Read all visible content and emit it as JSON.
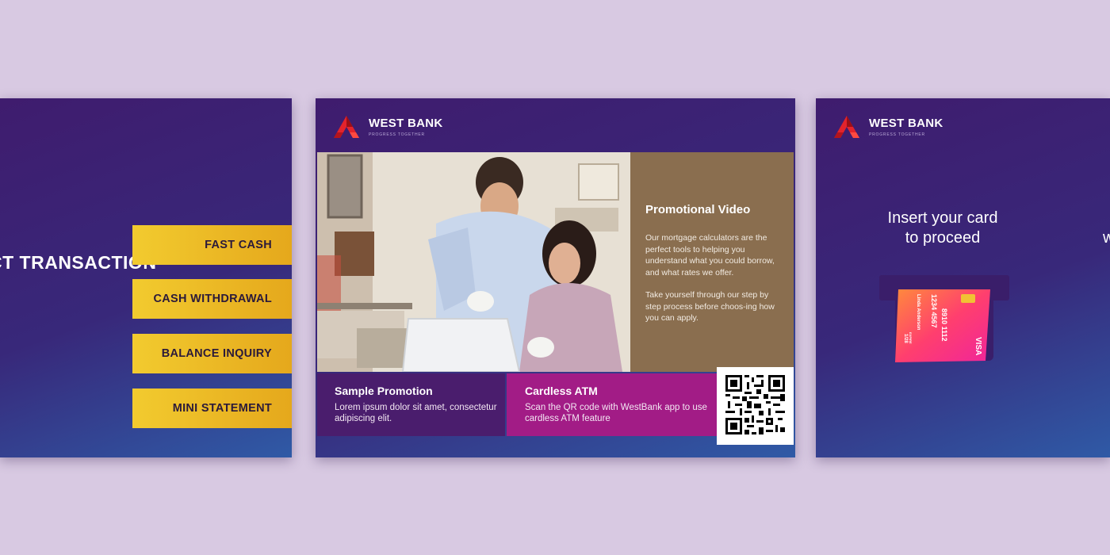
{
  "left_screen": {
    "title_partial": "CT TRANSACTION",
    "buttons": [
      "FAST CASH",
      "CASH WITHDRAWAL",
      "BALANCE INQUIRY",
      "MINI STATEMENT"
    ]
  },
  "brand": {
    "name": "WEST BANK",
    "tagline": "PROGRESS TOGETHER"
  },
  "middle_screen": {
    "promo_video": {
      "title": "Promotional Video",
      "text1": "Our mortgage calculators are the perfect tools to helping you understand what you could borrow, and what rates we offer.",
      "text2": "Take yourself through our step by step process before choos-ing how you can apply."
    },
    "sample_promotion": {
      "title": "Sample Promotion",
      "text": "Lorem ipsum dolor sit amet, consectetur adipiscing elit."
    },
    "cardless_atm": {
      "title": "Cardless ATM",
      "text": "Scan the QR code with WestBank app to use cardless ATM feature"
    }
  },
  "right_screen": {
    "line1": "Insert your card",
    "line2": "to proceed",
    "edge_char": "w",
    "card": {
      "number_line1": "1234 4567",
      "number_line2": "8910 1112",
      "name": "Linda Anderson",
      "expiry_label": "EXPIRE",
      "expiry": "1/28",
      "brand": "VISA"
    }
  },
  "colors": {
    "background": "#d8c9e2",
    "screen_top": "#3f1c6e",
    "screen_bottom": "#2f5aa6",
    "button_yellow": "#f2cb2f",
    "promo_brown": "#8a6e4f",
    "promo_purple": "#4a1d6d",
    "promo_magenta": "#a21c86",
    "logo_red": "#e3232c"
  }
}
